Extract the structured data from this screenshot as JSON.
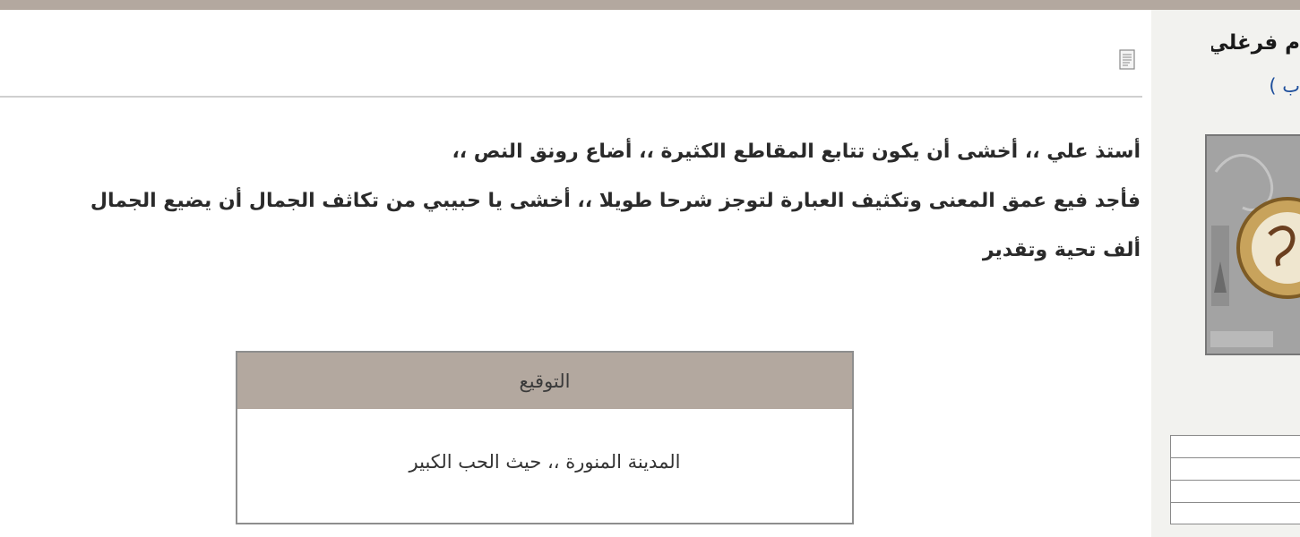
{
  "post": {
    "lines": [
      "أستذ علي ،، أخشى أن يكون تتابع المقاطع الكثيرة ،، أضاع رونق النص ،،",
      "فأجد فيع عمق المعنى وتكثيف العبارة لتوجز شرحا طويلا ،، أخشى يا حبيبي من تكاثف الجمال أن يضيع الجمال",
      "ألف تحية وتقدير"
    ],
    "icon": "post-document-icon"
  },
  "signature": {
    "header": "التوقيع",
    "text": "المدينة المنورة ،، حيث الحب الكبير"
  },
  "user": {
    "name": "م فرغلي",
    "link": "ب )",
    "avatar_icon": "avatar-image"
  },
  "colors": {
    "bar": "#b3a89f",
    "sidebar": "#f2f2ef",
    "link": "#1e4f9c"
  }
}
